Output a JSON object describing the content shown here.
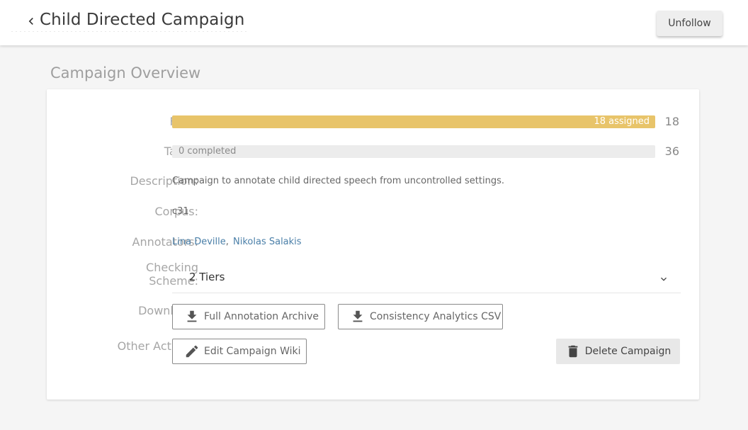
{
  "header": {
    "title": "Child Directed Campaign",
    "unfollow_label": "Unfollow"
  },
  "overview": {
    "section_title": "Campaign Overview",
    "labels": {
      "files": "Files:",
      "tasks": "Tasks:",
      "description": "Description:",
      "corpus": "Corpus:",
      "annotators": "Annotators:",
      "checking_scheme_line1": "Checking",
      "checking_scheme_line2": "Scheme:",
      "download": "Download:",
      "other_actions": "Other Actions:"
    },
    "files": {
      "bar_text": "18 assigned",
      "count": "18",
      "fraction": 1.0
    },
    "tasks": {
      "bar_text": "0 completed",
      "count": "36",
      "fraction": 0.0
    },
    "description": "Campaign to annotate child directed speech from uncontrolled settings.",
    "corpus": "c31",
    "annotators": [
      "Lina Deville",
      "Nikolas Salakis"
    ],
    "annotator_separator": ",",
    "checking_scheme": "2 Tiers",
    "download_buttons": {
      "archive": "Full Annotation Archive",
      "csv": "Consistency Analytics CSV"
    },
    "actions": {
      "edit_wiki": "Edit Campaign Wiki",
      "delete": "Delete Campaign"
    }
  },
  "colors": {
    "progress_fill": "#e8c46a",
    "link": "#4a7fa8",
    "label": "#a6a6a6"
  },
  "icons": {
    "back": "chevron-left-icon",
    "select": "chevron-down-icon",
    "download": "download-icon",
    "edit": "pencil-icon",
    "delete": "trash-icon"
  }
}
